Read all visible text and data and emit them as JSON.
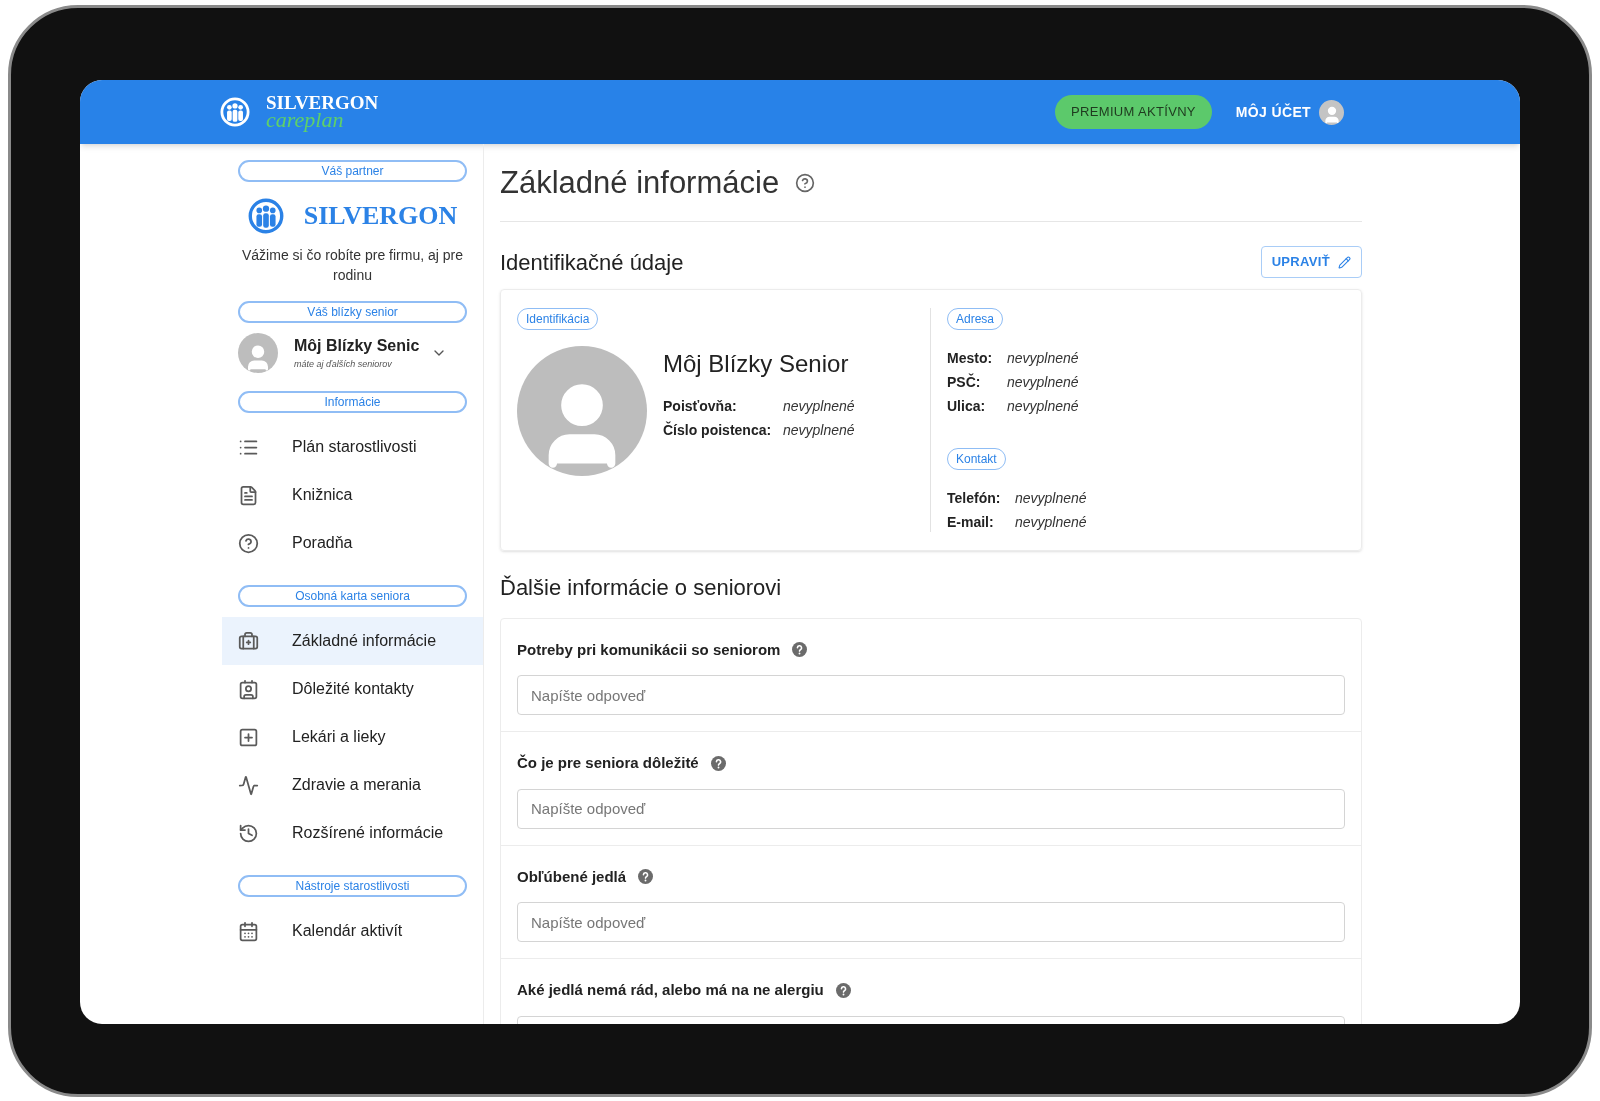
{
  "header": {
    "logo_top": "SILVERGON",
    "logo_bottom": "careplan",
    "premium_badge": "PREMIUM AKTÍVNY",
    "account_link": "MÔJ ÚČET"
  },
  "sidebar": {
    "partner_label": "Váš partner",
    "partner_name": "SILVERGON",
    "partner_tagline": "Vážime si čo robíte pre firmu, aj pre rodinu",
    "senior_label": "Váš blízky senior",
    "senior_name": "Môj Blízky Senic",
    "senior_hint": "máte aj ďalších seniorov",
    "sections": [
      {
        "label": "Informácie",
        "items": [
          {
            "label": "Plán starostlivosti",
            "selected": false
          },
          {
            "label": "Knižnica",
            "selected": false
          },
          {
            "label": "Poradňa",
            "selected": false
          }
        ]
      },
      {
        "label": "Osobná karta seniora",
        "items": [
          {
            "label": "Základné informácie",
            "selected": true
          },
          {
            "label": "Dôležité kontakty",
            "selected": false
          },
          {
            "label": "Lekári a lieky",
            "selected": false
          },
          {
            "label": "Zdravie a merania",
            "selected": false
          },
          {
            "label": "Rozšírené informácie",
            "selected": false
          }
        ]
      },
      {
        "label": "Nástroje starostlivosti",
        "items": [
          {
            "label": "Kalendár aktivít",
            "selected": false
          }
        ]
      }
    ]
  },
  "main": {
    "title": "Základné informácie",
    "identification": {
      "heading": "Identifikačné údaje",
      "edit_button": "UPRAVIŤ",
      "id_tag": "Identifikácia",
      "name": "Môj Blízky Senior",
      "id_fields": [
        {
          "label": "Poisťovňa:",
          "value": "nevyplnené"
        },
        {
          "label": "Číslo poistenca:",
          "value": "nevyplnené"
        }
      ],
      "address_tag": "Adresa",
      "address_fields": [
        {
          "label": "Mesto:",
          "value": "nevyplnené"
        },
        {
          "label": "PSČ:",
          "value": "nevyplnené"
        },
        {
          "label": "Ulica:",
          "value": "nevyplnené"
        }
      ],
      "contact_tag": "Kontakt",
      "contact_fields": [
        {
          "label": "Telefón:",
          "value": "nevyplnené"
        },
        {
          "label": "E-mail:",
          "value": "nevyplnené"
        }
      ]
    },
    "more": {
      "heading": "Ďalšie informácie o seniorovi",
      "questions": [
        {
          "label": "Potreby pri komunikácii so seniorom",
          "placeholder": "Napíšte odpoveď"
        },
        {
          "label": "Čo je pre seniora dôležité",
          "placeholder": "Napíšte odpoveď"
        },
        {
          "label": "Obľúbené jedlá",
          "placeholder": "Napíšte odpoveď"
        },
        {
          "label": "Aké jedlá nemá rád, alebo má na ne alergiu"
        }
      ]
    }
  }
}
